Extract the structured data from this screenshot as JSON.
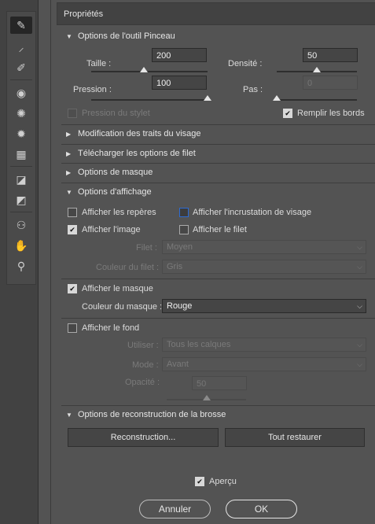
{
  "toolbar": {
    "tools": [
      {
        "icon": "forward-warp-icon",
        "glyph": "✎",
        "active": true
      },
      {
        "icon": "reconstruct-icon",
        "glyph": "⸝"
      },
      {
        "icon": "smooth-icon",
        "glyph": "✐"
      },
      {
        "icon": "twirl-icon",
        "glyph": "◉"
      },
      {
        "icon": "pucker-icon",
        "glyph": "✺"
      },
      {
        "icon": "bloat-icon",
        "glyph": "✹"
      },
      {
        "icon": "push-left-icon",
        "glyph": "▦"
      },
      {
        "icon": "freeze-mask-icon",
        "glyph": "◪"
      },
      {
        "icon": "thaw-mask-icon",
        "glyph": "◩"
      },
      {
        "icon": "face-tool-icon",
        "glyph": "⚇"
      },
      {
        "icon": "hand-icon",
        "glyph": "✋"
      },
      {
        "icon": "zoom-icon",
        "glyph": "⚲"
      }
    ]
  },
  "panel": {
    "title": "Propriétés"
  },
  "brush": {
    "title": "Options de l'outil Pinceau",
    "size_label": "Taille :",
    "size_value": "200",
    "size_level": 0.45,
    "density_label": "Densité :",
    "density_value": "50",
    "density_level": 0.5,
    "pressure_label": "Pression :",
    "pressure_value": "100",
    "pressure_level": 1.0,
    "rate_label": "Pas :",
    "rate_value": "0",
    "rate_level": 0.0,
    "stylus_label": "Pression du stylet",
    "pin_edges_label": "Remplir les bords"
  },
  "sections": {
    "face": "Modification des traits du visage",
    "mesh": "Télécharger les options de filet",
    "mask": "Options de masque",
    "view": "Options d'affichage",
    "reconstruct": "Options de reconstruction de la brosse"
  },
  "view": {
    "guides": "Afficher les repères",
    "face_overlay": "Afficher l'incrustation de visage",
    "image": "Afficher l'image",
    "mesh": "Afficher le filet",
    "mesh_size_label": "Filet :",
    "mesh_size_value": "Moyen",
    "mesh_color_label": "Couleur du filet :",
    "mesh_color_value": "Gris",
    "show_mask": "Afficher le masque",
    "mask_color_label": "Couleur du masque :",
    "mask_color_value": "Rouge",
    "show_backdrop": "Afficher le fond",
    "use_label": "Utiliser :",
    "use_value": "Tous les calques",
    "mode_label": "Mode :",
    "mode_value": "Avant",
    "opacity_label": "Opacité :",
    "opacity_value": "50",
    "opacity_level": 0.5
  },
  "reconstruct": {
    "reconstruct_button": "Reconstruction...",
    "restore_all_button": "Tout restaurer"
  },
  "footer": {
    "preview_label": "Aperçu",
    "cancel": "Annuler",
    "ok": "OK"
  },
  "colors": {
    "background": "#535353",
    "focus": "#2d6bd2"
  }
}
